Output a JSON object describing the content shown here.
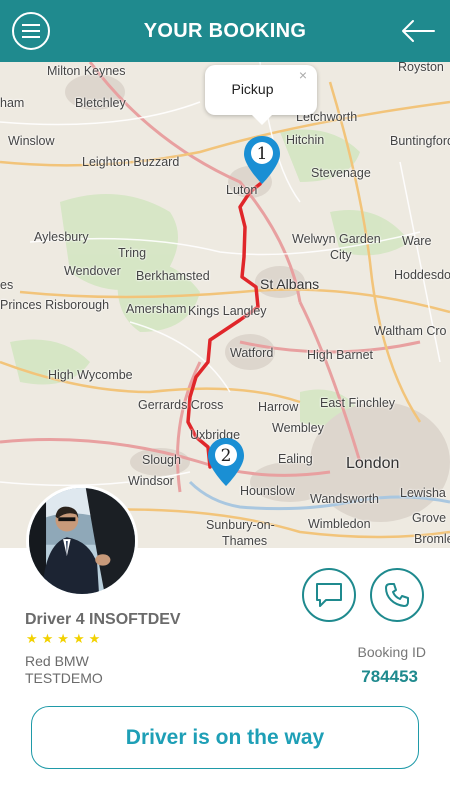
{
  "header": {
    "title": "YOUR BOOKING",
    "menu_icon": "hamburger-menu-icon",
    "back_icon": "arrow-left-icon"
  },
  "map": {
    "popup": {
      "label": "Pickup",
      "close": "×"
    },
    "pins": [
      {
        "number": "1"
      },
      {
        "number": "2"
      }
    ],
    "route_color": "#e0262a",
    "places": {
      "milton_keynes": "Milton Keynes",
      "royston": "Royston",
      "ham": "ham",
      "bletchley": "Bletchley",
      "letchworth": "Letchworth",
      "winslow": "Winslow",
      "hitchin": "Hitchin",
      "buntingford": "Buntingford",
      "leighton_buzzard": "Leighton Buzzard",
      "stevenage": "Stevenage",
      "luton": "Luton",
      "aylesbury": "Aylesbury",
      "welwyn": "Welwyn Garden",
      "city": "City",
      "ware": "Ware",
      "tring": "Tring",
      "wendover": "Wendover",
      "berkhamsted": "Berkhamsted",
      "hoddesdon": "Hoddesdo",
      "st_albans": "St Albans",
      "es": "es",
      "princes_risborough": "Princes Risborough",
      "kings_langley": "Kings Langley",
      "waltham_cross": "Waltham Cro",
      "amersham": "Amersham",
      "watford": "Watford",
      "high_barnet": "High Barnet",
      "high_wycombe": "High Wycombe",
      "east_finchley": "East Finchley",
      "gerrards_cross": "Gerrards Cross",
      "harrow": "Harrow",
      "wembley": "Wembley",
      "uxbridge": "Uxbridge",
      "slough": "Slough",
      "ealing": "Ealing",
      "london": "London",
      "windsor": "Windsor",
      "hounslow": "Hounslow",
      "wandsworth": "Wandsworth",
      "lewisham": "Lewisha",
      "grove": "Grove",
      "wimbledon": "Wimbledon",
      "sunbury": "Sunbury-on-",
      "thames": "Thames",
      "bromley": "Bromle"
    }
  },
  "driver": {
    "name": "Driver 4 INSOFTDEV",
    "rating_stars": "★★★★★",
    "car": "Red BMW",
    "plate": "TESTDEMO",
    "avatar_icon": "driver-photo"
  },
  "actions": {
    "message_icon": "chat-bubble-icon",
    "call_icon": "phone-icon"
  },
  "booking": {
    "label": "Booking ID",
    "id": "784453"
  },
  "status": {
    "label": "Driver is on the way"
  },
  "colors": {
    "primary": "#1f8a8e",
    "status_text": "#1e9fb6",
    "star": "#f2d100"
  }
}
